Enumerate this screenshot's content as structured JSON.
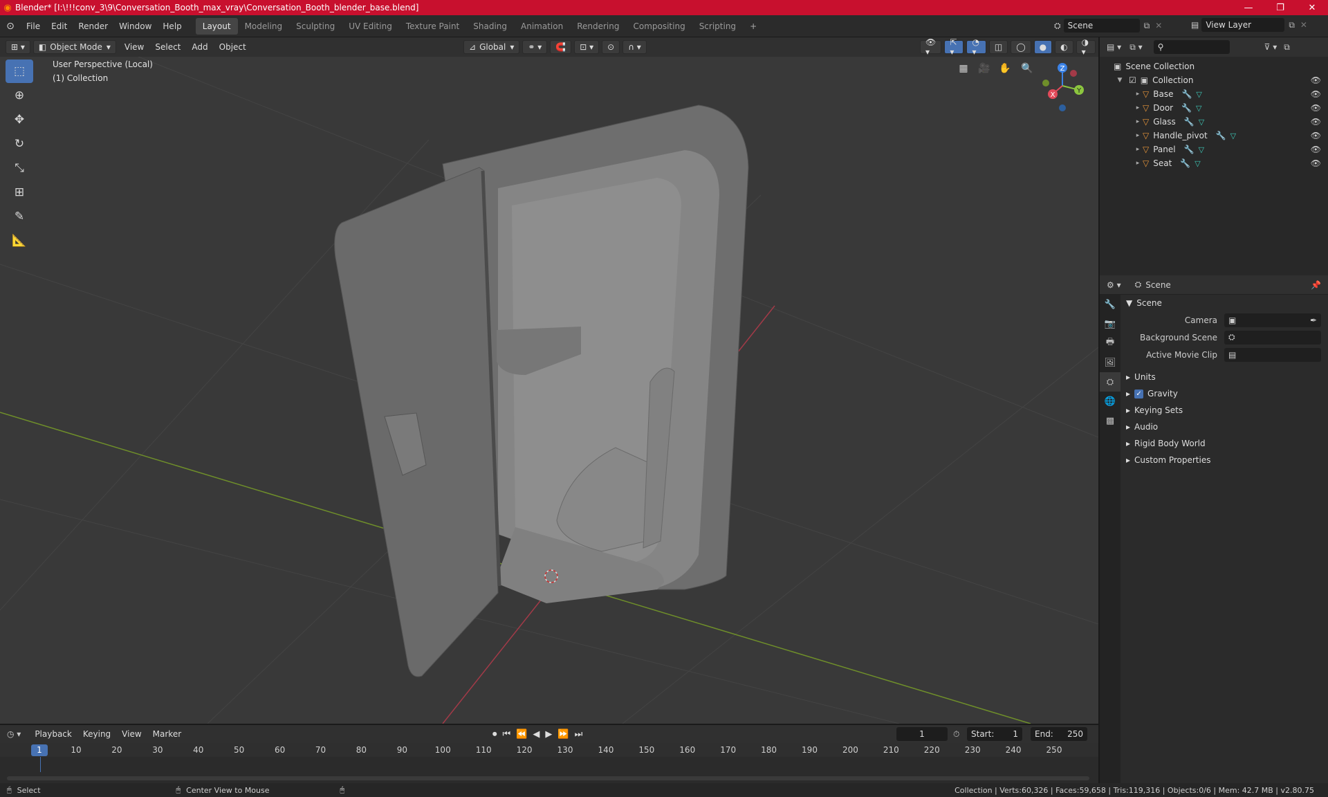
{
  "window": {
    "title": "Blender* [I:\\!!!conv_3\\9\\Conversation_Booth_max_vray\\Conversation_Booth_blender_base.blend]",
    "minimize_icon": "minimize-icon",
    "maximize_icon": "restore-icon",
    "close_icon": "close-icon"
  },
  "menu": [
    "File",
    "Edit",
    "Render",
    "Window",
    "Help"
  ],
  "workspaces": [
    "Layout",
    "Modeling",
    "Sculpting",
    "UV Editing",
    "Texture Paint",
    "Shading",
    "Animation",
    "Rendering",
    "Compositing",
    "Scripting"
  ],
  "active_workspace": "Layout",
  "scene_name": "Scene",
  "view_layer": "View Layer",
  "header3d": {
    "mode": "Object Mode",
    "menus": [
      "View",
      "Select",
      "Add",
      "Object"
    ],
    "orientation": "Global"
  },
  "viewport": {
    "perspective_label": "User Perspective (Local)",
    "collection_label": "(1) Collection",
    "gizmo_axes": [
      "X",
      "Y",
      "Z"
    ]
  },
  "outliner": {
    "root": "Scene Collection",
    "collection": "Collection",
    "objects": [
      "Base",
      "Door",
      "Glass",
      "Handle_pivot",
      "Panel",
      "Seat"
    ]
  },
  "properties": {
    "header": "Scene",
    "panel_title": "Scene",
    "camera_label": "Camera",
    "background_scene_label": "Background Scene",
    "active_movie_clip_label": "Active Movie Clip",
    "sections": [
      "Units",
      "Gravity",
      "Keying Sets",
      "Audio",
      "Rigid Body World",
      "Custom Properties"
    ]
  },
  "timeline": {
    "menus": [
      "Playback",
      "Keying",
      "View",
      "Marker"
    ],
    "current_frame": "1",
    "start_label": "Start:",
    "start_value": "1",
    "end_label": "End:",
    "end_value": "250",
    "ticks": [
      "1",
      "10",
      "20",
      "30",
      "40",
      "50",
      "60",
      "70",
      "80",
      "90",
      "100",
      "110",
      "120",
      "130",
      "140",
      "150",
      "160",
      "170",
      "180",
      "190",
      "200",
      "210",
      "220",
      "230",
      "240",
      "250"
    ]
  },
  "status": {
    "select": "Select",
    "center_view": "Center View to Mouse",
    "stats": "Collection | Verts:60,326 | Faces:59,658 | Tris:119,316 | Objects:0/6 | Mem: 42.7 MB | v2.80.75"
  },
  "colors": {
    "titlebar": "#c8102e",
    "active_blue": "#4772b3",
    "x_axis": "#e24a5a",
    "y_axis": "#8cc63f",
    "z_axis": "#3b82e6"
  }
}
